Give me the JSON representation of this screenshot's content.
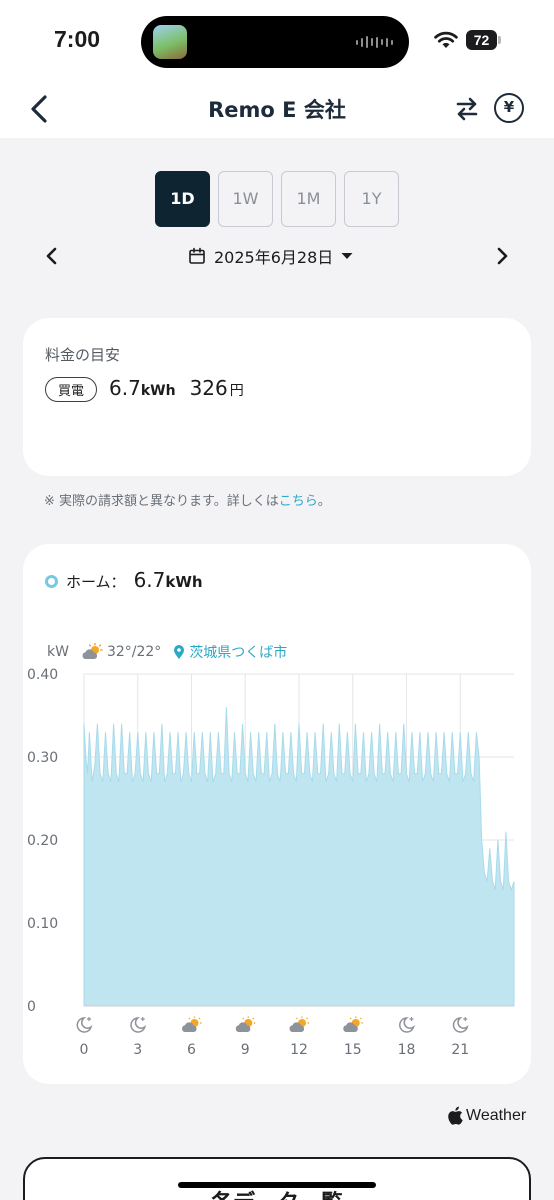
{
  "status": {
    "time": "7:00",
    "battery": "72"
  },
  "nav": {
    "title": "Remo E 会社",
    "yen_symbol": "¥"
  },
  "range_tabs": [
    {
      "label": "1D",
      "active": true
    },
    {
      "label": "1W",
      "active": false
    },
    {
      "label": "1M",
      "active": false
    },
    {
      "label": "1Y",
      "active": false
    }
  ],
  "date": {
    "label": "2025年6月28日"
  },
  "cost": {
    "title": "料金の目安",
    "badge": "買電",
    "energy_value": "6.7",
    "energy_unit": "kWh",
    "price_value": "326",
    "price_unit": "円"
  },
  "note": {
    "text": "※ 実際の請求額と異なります。詳しくは",
    "link": "こちら",
    "suffix": "。"
  },
  "chart_header": {
    "home_label": "ホーム：",
    "home_value": "6.7",
    "home_unit": "kWh",
    "unit_label": "kW",
    "temps": "32°/22°",
    "location": "茨城県つくば市"
  },
  "chart_data": {
    "type": "area",
    "xlabel": "",
    "ylabel": "kW",
    "xlim": [
      0,
      24
    ],
    "ylim": [
      0,
      0.4
    ],
    "y_ticks": [
      "0.40",
      "0.30",
      "0.20",
      "0.10",
      "0"
    ],
    "x_ticks": [
      "0",
      "3",
      "6",
      "9",
      "12",
      "15",
      "18",
      "21"
    ],
    "x_tick_weather": [
      "moon",
      "moon",
      "sun-cloud",
      "sun-cloud",
      "sun-cloud",
      "sun-cloud",
      "moon",
      "moon"
    ],
    "grid": true,
    "fill_color": "#bfe5f1",
    "line_color": "#a8dbea",
    "series": [
      {
        "x": [
          0,
          0.1,
          0.2,
          0.3,
          0.45,
          0.6,
          0.75,
          0.9,
          1.05,
          1.2,
          1.35,
          1.5,
          1.65,
          1.8,
          1.95,
          2.1,
          2.25,
          2.4,
          2.55,
          2.7,
          2.85,
          3,
          3.15,
          3.3,
          3.45,
          3.6,
          3.75,
          3.9,
          4.05,
          4.2,
          4.35,
          4.5,
          4.65,
          4.8,
          4.95,
          5.1,
          5.25,
          5.4,
          5.55,
          5.7,
          5.85,
          6,
          6.15,
          6.3,
          6.45,
          6.6,
          6.75,
          6.9,
          7.05,
          7.2,
          7.35,
          7.5,
          7.65,
          7.8,
          7.95,
          8.1,
          8.25,
          8.4,
          8.55,
          8.7,
          8.85,
          9,
          9.15,
          9.3,
          9.45,
          9.6,
          9.75,
          9.9,
          10.05,
          10.2,
          10.35,
          10.5,
          10.65,
          10.8,
          10.95,
          11.1,
          11.25,
          11.4,
          11.55,
          11.7,
          11.85,
          12,
          12.15,
          12.3,
          12.45,
          12.6,
          12.75,
          12.9,
          13.05,
          13.2,
          13.35,
          13.5,
          13.65,
          13.8,
          13.95,
          14.1,
          14.25,
          14.4,
          14.55,
          14.7,
          14.85,
          15,
          15.15,
          15.3,
          15.45,
          15.6,
          15.75,
          15.9,
          16.05,
          16.2,
          16.35,
          16.5,
          16.65,
          16.8,
          16.95,
          17.1,
          17.25,
          17.4,
          17.55,
          17.7,
          17.85,
          18,
          18.15,
          18.3,
          18.45,
          18.6,
          18.75,
          18.9,
          19.05,
          19.2,
          19.35,
          19.5,
          19.65,
          19.8,
          19.95,
          20.1,
          20.25,
          20.4,
          20.55,
          20.7,
          20.85,
          21,
          21.15,
          21.3,
          21.45,
          21.6,
          21.75,
          21.9,
          22.05,
          22.2,
          22.35,
          22.5,
          22.65,
          22.8,
          22.95,
          23.1,
          23.25,
          23.4,
          23.55,
          23.7,
          23.85,
          24
        ],
        "values": [
          0.34,
          0.3,
          0.28,
          0.33,
          0.27,
          0.29,
          0.34,
          0.28,
          0.27,
          0.33,
          0.28,
          0.27,
          0.34,
          0.28,
          0.27,
          0.34,
          0.28,
          0.28,
          0.33,
          0.27,
          0.28,
          0.33,
          0.28,
          0.27,
          0.33,
          0.28,
          0.27,
          0.33,
          0.28,
          0.28,
          0.34,
          0.27,
          0.28,
          0.33,
          0.28,
          0.28,
          0.33,
          0.27,
          0.28,
          0.33,
          0.28,
          0.27,
          0.33,
          0.28,
          0.28,
          0.33,
          0.28,
          0.27,
          0.33,
          0.27,
          0.28,
          0.33,
          0.28,
          0.28,
          0.36,
          0.28,
          0.27,
          0.33,
          0.28,
          0.28,
          0.34,
          0.28,
          0.27,
          0.33,
          0.28,
          0.27,
          0.33,
          0.28,
          0.28,
          0.33,
          0.27,
          0.28,
          0.34,
          0.28,
          0.27,
          0.33,
          0.28,
          0.28,
          0.33,
          0.28,
          0.27,
          0.34,
          0.28,
          0.28,
          0.33,
          0.28,
          0.27,
          0.33,
          0.28,
          0.28,
          0.34,
          0.27,
          0.28,
          0.33,
          0.28,
          0.27,
          0.34,
          0.28,
          0.28,
          0.33,
          0.28,
          0.27,
          0.34,
          0.28,
          0.28,
          0.33,
          0.27,
          0.28,
          0.33,
          0.28,
          0.27,
          0.34,
          0.28,
          0.28,
          0.33,
          0.28,
          0.27,
          0.33,
          0.28,
          0.28,
          0.34,
          0.28,
          0.27,
          0.33,
          0.28,
          0.28,
          0.33,
          0.27,
          0.28,
          0.33,
          0.28,
          0.27,
          0.33,
          0.28,
          0.28,
          0.33,
          0.28,
          0.27,
          0.33,
          0.28,
          0.28,
          0.33,
          0.27,
          0.28,
          0.33,
          0.28,
          0.27,
          0.33,
          0.3,
          0.2,
          0.16,
          0.15,
          0.19,
          0.15,
          0.14,
          0.2,
          0.15,
          0.14,
          0.21,
          0.15,
          0.14,
          0.15
        ]
      }
    ]
  },
  "footer": {
    "weather_attr": "Weather",
    "bottom_title": "各データ一覧"
  }
}
